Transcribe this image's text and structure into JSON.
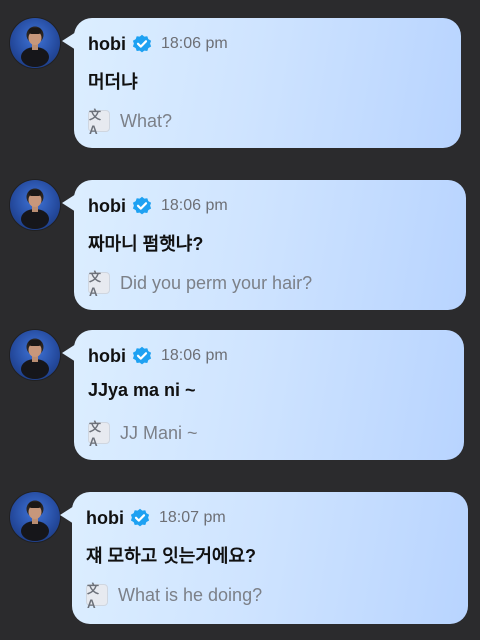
{
  "messages": [
    {
      "author": "hobi",
      "time": "18:06 pm",
      "text": "머더냐",
      "translation_icon": "translate-icon",
      "translation": "What?"
    },
    {
      "author": "hobi",
      "time": "18:06 pm",
      "text": "짜마니 펌햇냐?",
      "translation_icon": "translate-icon",
      "translation": "Did you perm your hair?"
    },
    {
      "author": "hobi",
      "time": "18:06 pm",
      "text": "JJya ma ni ~",
      "translation_icon": "translate-icon",
      "translation": "JJ Mani ~"
    },
    {
      "author": "hobi",
      "time": "18:07 pm",
      "text": "쟤 모하고 잇는거에요?",
      "translation_icon": "translate-icon",
      "translation": "What is he doing?"
    }
  ],
  "icons": {
    "verified": "verified-badge-icon",
    "avatar": "avatar-icon"
  },
  "colors": {
    "background": "#2b2b2d",
    "bubble": "#d4e8ff",
    "verified": "#1ea1f2"
  }
}
